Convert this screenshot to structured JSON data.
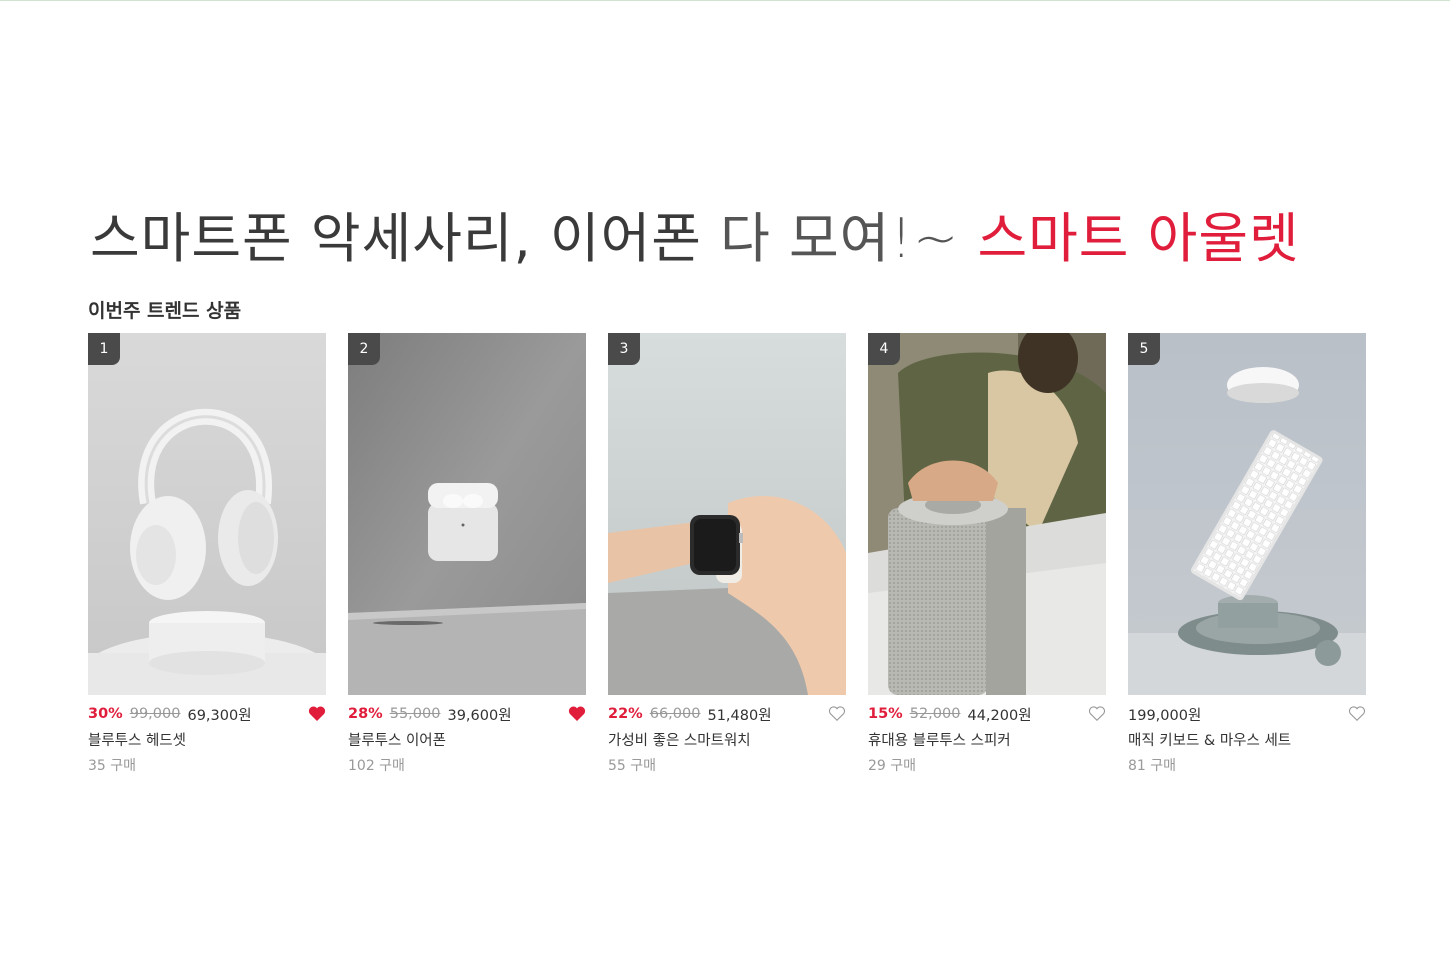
{
  "headline": {
    "part1": "스마트폰 악세사리, 이어폰",
    "part2": "다 모여!~",
    "part3": "스마트 아울렛"
  },
  "section_title": "이번주 트렌드 상품",
  "colors": {
    "accent": "#e01e3c",
    "rank_badge": "#4a4a4a"
  },
  "products": [
    {
      "rank": "1",
      "discount": "30%",
      "original_price": "99,000",
      "price": "69,300원",
      "name": "블루투스 헤드셋",
      "buys": "35 구매",
      "liked": true,
      "image": "white-headphones-on-pedestal"
    },
    {
      "rank": "2",
      "discount": "28%",
      "original_price": "55,000",
      "price": "39,600원",
      "name": "블루투스 이어폰",
      "buys": "102 구매",
      "liked": true,
      "image": "wireless-earbuds-case"
    },
    {
      "rank": "3",
      "discount": "22%",
      "original_price": "66,000",
      "price": "51,480원",
      "name": "가성비 좋은 스마트워치",
      "buys": "55 구매",
      "liked": false,
      "image": "smartwatch-on-wrist"
    },
    {
      "rank": "4",
      "discount": "15%",
      "original_price": "52,000",
      "price": "44,200원",
      "name": "휴대용 블루투스 스피커",
      "buys": "29 구매",
      "liked": false,
      "image": "smart-speaker-on-desk"
    },
    {
      "rank": "5",
      "discount": "",
      "original_price": "",
      "price": "199,000원",
      "name": "매직 키보드 & 마우스 세트",
      "buys": "81 구매",
      "liked": false,
      "image": "floating-keyboard-and-mouse"
    }
  ]
}
